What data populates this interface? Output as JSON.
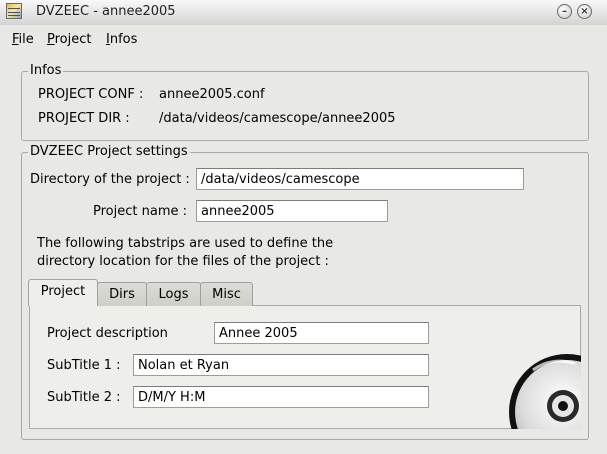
{
  "window": {
    "title": "DVZEEC - annee2005",
    "minimize_glyph": "–",
    "close_glyph": "×"
  },
  "menubar": {
    "file": {
      "mnemonic": "F",
      "rest": "ile"
    },
    "project": {
      "mnemonic": "P",
      "rest": "roject"
    },
    "infos": {
      "mnemonic": "I",
      "rest": "nfos"
    }
  },
  "infos": {
    "legend": "Infos",
    "conf_label": "PROJECT CONF :",
    "conf_value": "annee2005.conf",
    "dir_label": "PROJECT DIR :",
    "dir_value": "/data/videos/camescope/annee2005"
  },
  "settings": {
    "legend": "DVZEEC Project settings",
    "directory_label": "Directory of the project :",
    "directory_value": "/data/videos/camescope",
    "name_label": "Project name :",
    "name_value": "annee2005",
    "help_line1": "The following tabstrips are used to define the",
    "help_line2": "directory location for the files of the project :"
  },
  "tabs": [
    {
      "label": "Project",
      "active": true
    },
    {
      "label": "Dirs",
      "active": false
    },
    {
      "label": "Logs",
      "active": false
    },
    {
      "label": "Misc",
      "active": false
    }
  ],
  "project_tab": {
    "description_label": "Project description",
    "description_value": "Annee 2005",
    "subtitle1_label": "SubTitle 1 :",
    "subtitle1_value": "Nolan et Ryan",
    "subtitle2_label": "SubTitle 2 :",
    "subtitle2_value": "D/M/Y H:M"
  },
  "icons": {
    "app": "app-icon",
    "disc": "cd-disc-icon"
  }
}
